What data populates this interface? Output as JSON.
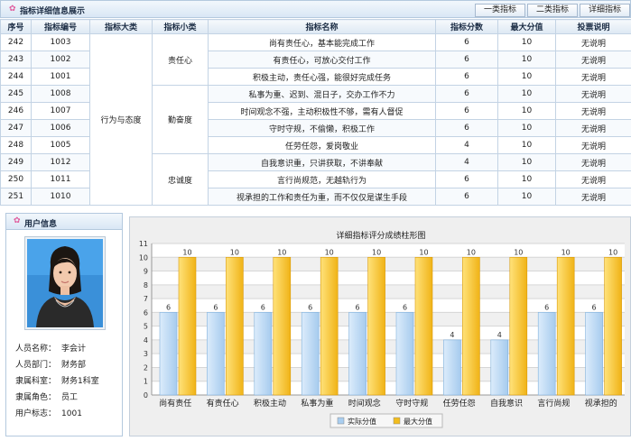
{
  "top_panel": {
    "title": "指标详细信息展示",
    "buttons": [
      "一类指标",
      "二类指标",
      "详细指标"
    ]
  },
  "table": {
    "headers": [
      "序号",
      "指标编号",
      "指标大类",
      "指标小类",
      "指标名称",
      "指标分数",
      "最大分值",
      "投票说明"
    ],
    "category": "行为与态度",
    "subcategories": [
      "责任心",
      "勤奋度",
      "忠诚度"
    ],
    "rows": [
      {
        "seq": "242",
        "code": "1003",
        "name": "尚有责任心，基本能完成工作",
        "score": "6",
        "max": "10",
        "vote": "无说明"
      },
      {
        "seq": "243",
        "code": "1002",
        "name": "有责任心，可放心交付工作",
        "score": "6",
        "max": "10",
        "vote": "无说明"
      },
      {
        "seq": "244",
        "code": "1001",
        "name": "积极主动，责任心强，能很好完成任务",
        "score": "6",
        "max": "10",
        "vote": "无说明"
      },
      {
        "seq": "245",
        "code": "1008",
        "name": "私事为重、迟到、混日子，交办工作不力",
        "score": "6",
        "max": "10",
        "vote": "无说明"
      },
      {
        "seq": "246",
        "code": "1007",
        "name": "时间观念不强，主动积极性不够，需有人督促",
        "score": "6",
        "max": "10",
        "vote": "无说明"
      },
      {
        "seq": "247",
        "code": "1006",
        "name": "守时守规，不偷懒，积极工作",
        "score": "6",
        "max": "10",
        "vote": "无说明"
      },
      {
        "seq": "248",
        "code": "1005",
        "name": "任劳任怨，爱岗敬业",
        "score": "4",
        "max": "10",
        "vote": "无说明"
      },
      {
        "seq": "249",
        "code": "1012",
        "name": "自我意识重，只讲获取，不讲奉献",
        "score": "4",
        "max": "10",
        "vote": "无说明"
      },
      {
        "seq": "250",
        "code": "1011",
        "name": "言行尚规范，无越轨行为",
        "score": "6",
        "max": "10",
        "vote": "无说明"
      },
      {
        "seq": "251",
        "code": "1010",
        "name": "视承担的工作和责任为重，而不仅仅是谋生手段",
        "score": "6",
        "max": "10",
        "vote": "无说明"
      }
    ]
  },
  "user_panel": {
    "title": "用户信息",
    "fields": [
      {
        "label": "人员名称：",
        "value": "李会计"
      },
      {
        "label": "人员部门：",
        "value": "财务部"
      },
      {
        "label": "隶属科室：",
        "value": "财务1科室"
      },
      {
        "label": "隶属角色：",
        "value": "员工"
      },
      {
        "label": "用户标志：",
        "value": "1001"
      }
    ]
  },
  "chart_data": {
    "type": "bar",
    "title": "详细指标评分成绩柱形图",
    "categories": [
      "尚有责任",
      "有责任心",
      "积极主动",
      "私事为重",
      "时间观念",
      "守时守规",
      "任劳任怨",
      "自我意识",
      "言行尚规",
      "视承担的"
    ],
    "series": [
      {
        "name": "实际分值",
        "values": [
          6,
          6,
          6,
          6,
          6,
          6,
          4,
          4,
          6,
          6
        ],
        "color": "#a9cef0"
      },
      {
        "name": "最大分值",
        "values": [
          10,
          10,
          10,
          10,
          10,
          10,
          10,
          10,
          10,
          10
        ],
        "color": "#f2bd1e"
      }
    ],
    "ylim": [
      0,
      11
    ],
    "yticks": [
      0,
      1,
      2,
      3,
      4,
      5,
      6,
      7,
      8,
      9,
      10,
      11
    ],
    "grid": true,
    "legend": "bottom"
  }
}
